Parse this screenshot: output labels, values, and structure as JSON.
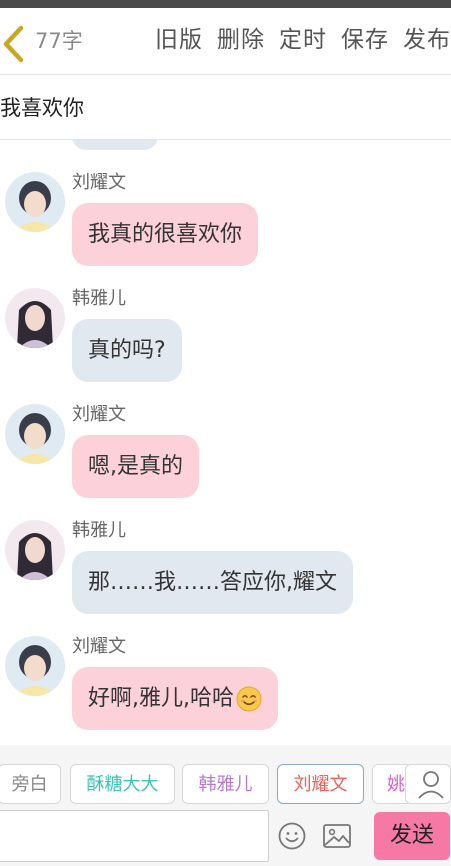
{
  "header": {
    "word_count": "77字",
    "actions": [
      "旧版",
      "删除",
      "定时",
      "保存",
      "发布"
    ],
    "title": "我喜欢你"
  },
  "messages": [
    {
      "sender": "刘耀文",
      "text": "我真的很喜欢你",
      "side": "pink"
    },
    {
      "sender": "韩雅儿",
      "text": "真的吗?",
      "side": "gray"
    },
    {
      "sender": "刘耀文",
      "text": "嗯,是真的",
      "side": "pink"
    },
    {
      "sender": "韩雅儿",
      "text": "那……我……答应你,耀文",
      "side": "gray"
    },
    {
      "sender": "刘耀文",
      "text": "好啊,雅儿,哈哈",
      "side": "pink",
      "emoji": "smiling-face-icon"
    }
  ],
  "roles": [
    {
      "label": "旁白",
      "color": "#888888"
    },
    {
      "label": "酥糖大大",
      "color": "#3cc4b4"
    },
    {
      "label": "韩雅儿",
      "color": "#b47ad0"
    },
    {
      "label": "刘耀文",
      "color": "#e8625a",
      "selected": true
    },
    {
      "label": "姚",
      "color": "#d85fc4"
    }
  ],
  "input": {
    "placeholder": "",
    "send_label": "发送"
  },
  "colors": {
    "pink_bubble": "#fdd1da",
    "gray_bubble": "#e1e8ef",
    "send_button": "#f579a4",
    "back_arrow": "#c9a521"
  }
}
